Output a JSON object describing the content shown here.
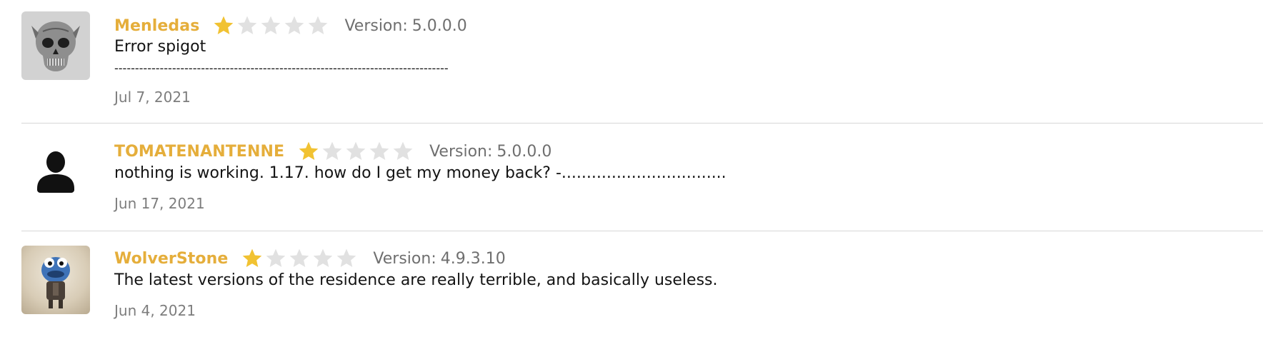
{
  "reviews": [
    {
      "username": "Menledas",
      "rating": 1,
      "max_rating": 5,
      "version_label": "Version:",
      "version": "5.0.0.0",
      "message": "Error spigot",
      "message_extra": "---------------------------------------------------------------------------------",
      "date": "Jul 7, 2021",
      "avatar": "skull-avatar"
    },
    {
      "username": "TOMATENANTENNE",
      "rating": 1,
      "max_rating": 5,
      "version_label": "Version:",
      "version": "5.0.0.0",
      "message": "nothing is working. 1.17. how do I get my money back? -.................................",
      "date": "Jun 17, 2021",
      "avatar": "default-user-avatar"
    },
    {
      "username": "WolverStone",
      "rating": 1,
      "max_rating": 5,
      "version_label": "Version:",
      "version": "4.9.3.10",
      "message": "The latest versions of the residence are really terrible, and basically useless.",
      "date": "Jun 4, 2021",
      "avatar": "creature-avatar"
    }
  ],
  "colors": {
    "username": "#e5ae3b",
    "star_filled": "#f1c232",
    "star_empty": "#e1e1e1",
    "version_text": "#6f6f6f",
    "date_text": "#7d7d7d",
    "divider": "#d7d7d7"
  }
}
